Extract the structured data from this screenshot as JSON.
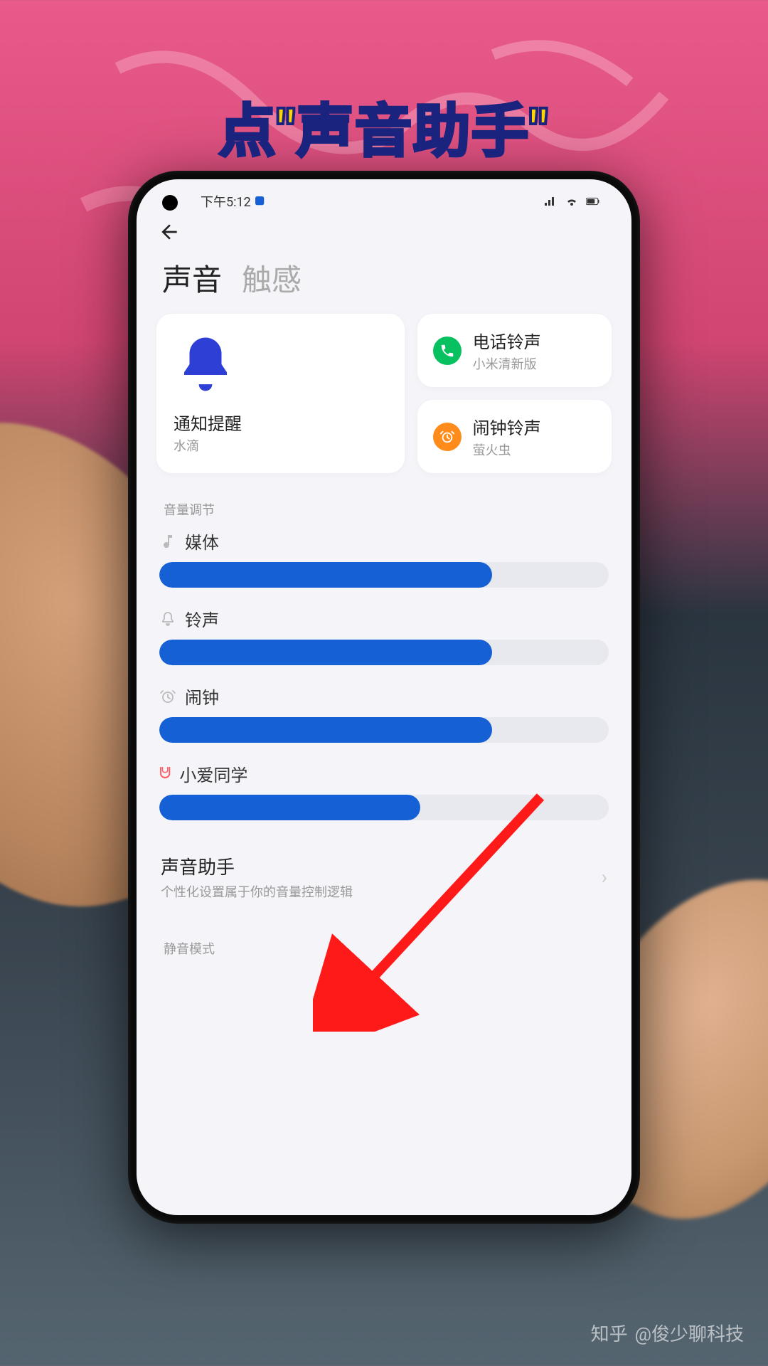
{
  "caption": "点\"声音助手\"",
  "status": {
    "time": "下午5:12"
  },
  "tabs": {
    "sound": "声音",
    "touch": "触感"
  },
  "cards": {
    "notify": {
      "title": "通知提醒",
      "sub": "水滴"
    },
    "phone": {
      "title": "电话铃声",
      "sub": "小米清新版"
    },
    "alarm": {
      "title": "闹钟铃声",
      "sub": "萤火虫"
    }
  },
  "sections": {
    "volume_adjust": "音量调节",
    "mute_mode": "静音模式"
  },
  "sliders": {
    "media": {
      "label": "媒体",
      "value": 74
    },
    "ring": {
      "label": "铃声",
      "value": 74
    },
    "alarm": {
      "label": "闹钟",
      "value": 74
    },
    "xiaoai": {
      "label": "小爱同学",
      "value": 58
    }
  },
  "sound_assistant": {
    "title": "声音助手",
    "sub": "个性化设置属于你的音量控制逻辑"
  },
  "watermark": {
    "site": "知乎",
    "author": "@俊少聊科技"
  },
  "colors": {
    "accent": "#1560d4"
  }
}
